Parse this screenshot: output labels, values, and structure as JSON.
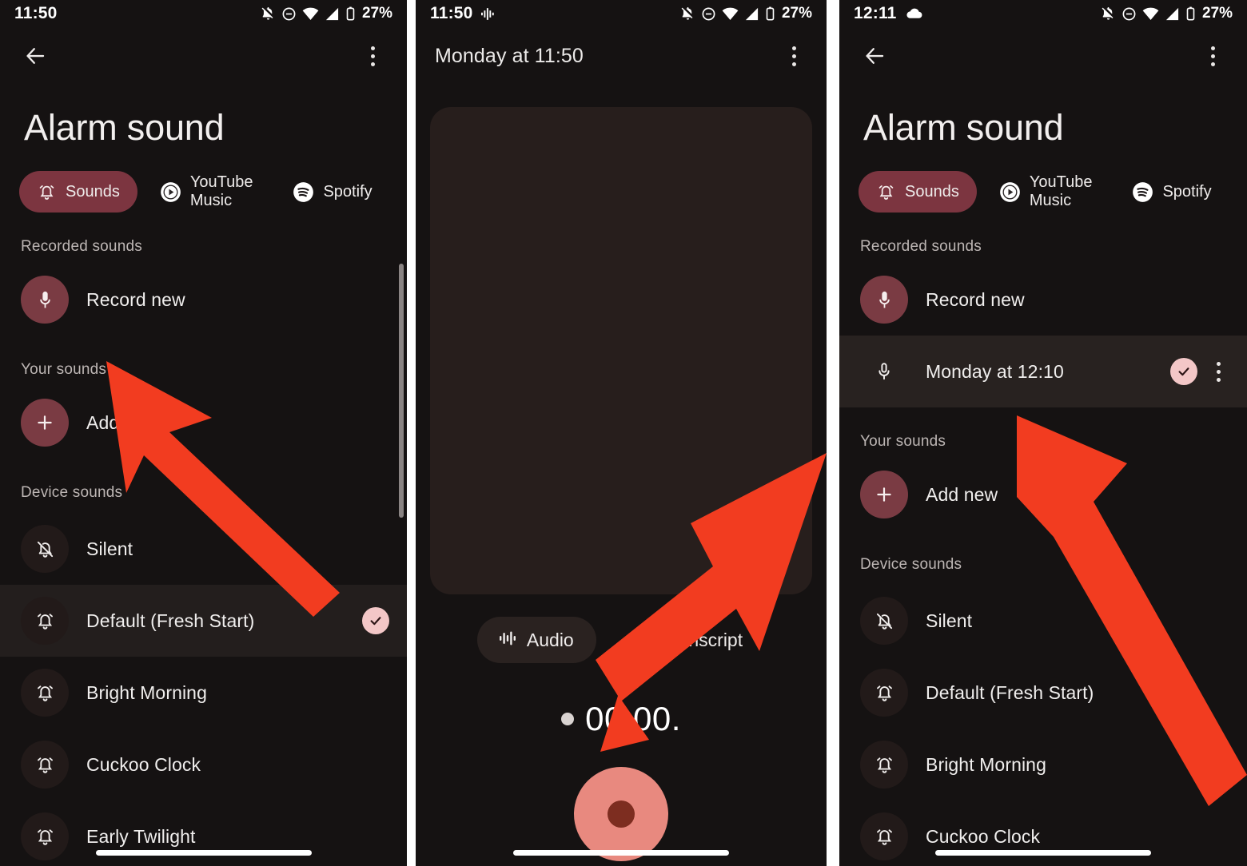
{
  "colors": {
    "background": "#151212",
    "accent_chip": "#7c3540",
    "avatar_accent": "#7a3b43",
    "check_badge": "#f3c7c7",
    "record_button": "#e8897f",
    "record_button_inner": "#7d2d20",
    "arrow": "#f23c20",
    "card": "#271e1c",
    "selected_row": "#231e1d"
  },
  "panel1": {
    "status_bar": {
      "clock": "11:50",
      "battery": "27%",
      "icons": [
        "bell-off-icon",
        "do-not-disturb-icon",
        "wifi-icon",
        "signal-icon",
        "battery-icon"
      ]
    },
    "appbar": {
      "back": "back-arrow-icon",
      "overflow": "more-options-icon"
    },
    "page_title": "Alarm sound",
    "tabs": [
      {
        "label": "Sounds",
        "icon": "alarm-bell-icon",
        "active": true
      },
      {
        "label": "YouTube Music",
        "icon": "youtube-music-icon",
        "active": false
      },
      {
        "label": "Spotify",
        "icon": "spotify-icon",
        "active": false
      }
    ],
    "sections": [
      {
        "label": "Recorded sounds",
        "items": [
          {
            "label": "Record new",
            "icon": "microphone-icon",
            "avatar": "filled",
            "selected": false,
            "checked": false
          }
        ]
      },
      {
        "label": "Your sounds",
        "items": [
          {
            "label": "Add new",
            "icon": "plus-icon",
            "avatar": "filled",
            "selected": false,
            "checked": false
          }
        ]
      },
      {
        "label": "Device sounds",
        "items": [
          {
            "label": "Silent",
            "icon": "bell-off-icon",
            "avatar": "faint",
            "selected": false,
            "checked": false
          },
          {
            "label": "Default (Fresh Start)",
            "icon": "alarm-bell-icon",
            "avatar": "faint",
            "selected": true,
            "checked": true
          },
          {
            "label": "Bright Morning",
            "icon": "alarm-bell-icon",
            "avatar": "faint",
            "selected": false,
            "checked": false
          },
          {
            "label": "Cuckoo Clock",
            "icon": "alarm-bell-icon",
            "avatar": "faint",
            "selected": false,
            "checked": false
          },
          {
            "label": "Early Twilight",
            "icon": "alarm-bell-icon",
            "avatar": "faint",
            "selected": false,
            "checked": false
          }
        ]
      }
    ]
  },
  "panel2": {
    "status_bar": {
      "clock": "11:50",
      "battery": "27%",
      "icons": [
        "recording-waveform-icon",
        "bell-off-icon",
        "do-not-disturb-icon",
        "wifi-icon",
        "signal-icon",
        "battery-icon"
      ]
    },
    "appbar": {
      "title": "Monday at 11:50",
      "overflow": "more-options-icon"
    },
    "segments": [
      {
        "label": "Audio",
        "icon": "waveform-icon",
        "active": true
      },
      {
        "label": "Transcript",
        "icon": "transcript-lines-icon",
        "active": false
      }
    ],
    "timer": "00:00.",
    "record_button": "record-button"
  },
  "panel3": {
    "status_bar": {
      "clock": "12:11",
      "battery": "27%",
      "icons": [
        "cloud-icon",
        "bell-off-icon",
        "do-not-disturb-icon",
        "wifi-icon",
        "signal-icon",
        "battery-icon"
      ]
    },
    "appbar": {
      "back": "back-arrow-icon",
      "overflow": "more-options-icon"
    },
    "page_title": "Alarm sound",
    "tabs": [
      {
        "label": "Sounds",
        "icon": "alarm-bell-icon",
        "active": true
      },
      {
        "label": "YouTube Music",
        "icon": "youtube-music-icon",
        "active": false
      },
      {
        "label": "Spotify",
        "icon": "spotify-icon",
        "active": false
      }
    ],
    "sections": [
      {
        "label": "Recorded sounds",
        "items": [
          {
            "label": "Record new",
            "icon": "microphone-icon",
            "avatar": "filled",
            "selected": false,
            "checked": false
          },
          {
            "label": "Monday at 12:10",
            "icon": "microphone-icon",
            "avatar": "plain",
            "selected": true,
            "checked": true,
            "overflow": true
          }
        ]
      },
      {
        "label": "Your sounds",
        "items": [
          {
            "label": "Add new",
            "icon": "plus-icon",
            "avatar": "filled",
            "selected": false,
            "checked": false
          }
        ]
      },
      {
        "label": "Device sounds",
        "items": [
          {
            "label": "Silent",
            "icon": "bell-off-icon",
            "avatar": "faint",
            "selected": false,
            "checked": false
          },
          {
            "label": "Default (Fresh Start)",
            "icon": "alarm-bell-icon",
            "avatar": "faint",
            "selected": false,
            "checked": false
          },
          {
            "label": "Bright Morning",
            "icon": "alarm-bell-icon",
            "avatar": "faint",
            "selected": false,
            "checked": false
          },
          {
            "label": "Cuckoo Clock",
            "icon": "alarm-bell-icon",
            "avatar": "faint",
            "selected": false,
            "checked": false
          }
        ]
      }
    ]
  },
  "annotations": [
    {
      "name": "arrow-to-record-new",
      "target": "Record new"
    },
    {
      "name": "arrow-to-record-button",
      "target": "record-button"
    },
    {
      "name": "arrow-to-recorded-sound",
      "target": "Monday at 12:10"
    }
  ]
}
